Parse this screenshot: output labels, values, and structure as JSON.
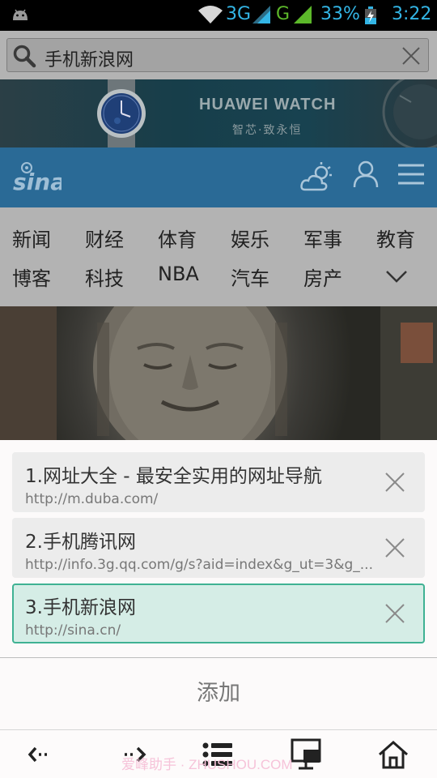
{
  "status_bar": {
    "network_1": "3G",
    "network_2": "G",
    "battery": "33%",
    "time": "3:22",
    "icons": [
      "android-icon",
      "wifi-icon",
      "signal-icon",
      "signal-icon",
      "battery-charging-icon"
    ]
  },
  "address_bar": {
    "text": "手机新浪网",
    "icons": [
      "search-icon",
      "clear-icon"
    ]
  },
  "ad": {
    "brand": "HUAWEI WATCH",
    "slogan": "智芯·致永恒"
  },
  "sina_header": {
    "logo": "sina",
    "icons": [
      "weather-icon",
      "user-icon",
      "menu-icon"
    ]
  },
  "nav": {
    "row1": [
      "新闻",
      "财经",
      "体育",
      "娱乐",
      "军事",
      "教育"
    ],
    "row2": [
      "博客",
      "科技",
      "NBA",
      "汽车",
      "房产"
    ],
    "more_icon": "chevron-down-icon"
  },
  "window_list": {
    "items": [
      {
        "title": "1.网址大全 - 最安全实用的网址导航",
        "url": "http://m.duba.com/",
        "active": false
      },
      {
        "title": "2.手机腾讯网",
        "url": "http://info.3g.qq.com/g/s?aid=index&g_ut=3&g_...",
        "active": false
      },
      {
        "title": "3.手机新浪网",
        "url": "http://sina.cn/",
        "active": true
      }
    ],
    "add_label": "添加"
  },
  "toolbar": {
    "icons": [
      "back-icon",
      "forward-icon",
      "list-icon",
      "windows-icon",
      "home-icon"
    ],
    "watermark": "爱峰助手 · ZHUSHOU.COM"
  },
  "colors": {
    "accent": "#33b5e5",
    "sina_blue": "#2a6a96",
    "active_border": "#3fb293",
    "active_bg": "#d5ede6"
  }
}
